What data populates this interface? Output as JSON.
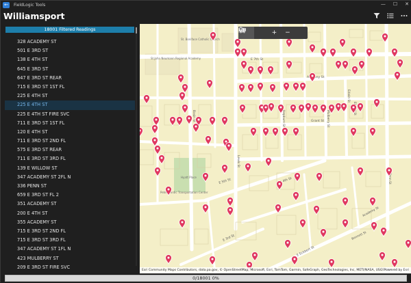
{
  "titlebar": {
    "back_glyph": "←",
    "app_title": "FieldLogic Tools",
    "minimize_glyph": "—",
    "maximize_glyph": "☐",
    "close_glyph": "✕"
  },
  "header": {
    "title": "Williamsport",
    "filter_icon": "filter-icon",
    "list_icon": "list-icon",
    "more_icon": "more-icon"
  },
  "sidebar": {
    "filter_label": "18001 Filtered Readings",
    "items": [
      "328 ACADEMY ST",
      "501 E 3RD ST",
      "138 E 4TH ST",
      "645 E 3RD ST",
      "647 E 3RD ST REAR",
      "715 E 3RD ST 1ST FL",
      "225 E 4TH ST",
      "225 E 4TH ST",
      "225 E 4TH ST FIRE SVC",
      "711 E 3RD ST 1ST FL",
      "120 E 4TH ST",
      "711 E 3RD ST 2ND FL",
      "575 E 3RD ST REAR",
      "711 E 3RD ST 3RD FL",
      "139 E WILLOW ST",
      "347 ACADEMY ST 2FL N",
      "336 PENN ST",
      "659 E 3RD ST FL 2",
      "351 ACADEMY ST",
      "200 E 4TH ST",
      "355 ACADEMY ST",
      "715 E 3RD ST 2ND FL",
      "715 E 3RD ST 3RD FL",
      "347 ACADEMY ST 1FL N",
      "423 MULBERRY ST",
      "209 E 3RD ST FIRE SVC"
    ],
    "selected_index": 7
  },
  "map": {
    "toolbar": {
      "vehicle_icon": "vehicle-icon",
      "layers_icon": "layers-icon",
      "zoom_in_label": "+",
      "zoom_out_label": "−",
      "locate_icon": "location-pin-icon",
      "screenshot_icon": "camera-icon"
    },
    "streets": {
      "e_7th": "E 7th St",
      "anthony": "Anthony St",
      "grant": "Grant St",
      "e_5th": "E 5th St",
      "e_4th": "E 4th St",
      "e_3rd": "E 3rd St",
      "basin": "Basin St",
      "lewis": "Lewis St",
      "hepburn": "Hepburn St",
      "mulberry": "Mulberry St",
      "penn": "Penn St",
      "edwin": "Edwin St",
      "eldred": "Eldred St",
      "academy": "Academy St",
      "bennett": "Bennett St",
      "e_eckbert": "E Eckbert St"
    },
    "pois": {
      "st_boniface": "St. Boniface Catholic Church",
      "st_john": "St John Neumann Regional Academy",
      "hyatt": "Hyatt Place",
      "peter": "Peter Herdic Transportation Center",
      "pin_color": "#e03860"
    },
    "attribution": "Esri Community Maps Contributors, data.pa.gov, © OpenStreetMap, Microsoft, Esri, TomTom, Garmin, SafeGraph, GeoTechnologies, Inc, METI/NASA, USGS, EPA, N...",
    "powered_by": "Powered by Esri"
  },
  "status": {
    "progress_text": "0/18001 0%",
    "progress_fraction": 0
  },
  "colors": {
    "accent": "#1d7eaa",
    "selected_text": "#76b6ea",
    "map_background": "#f4efc8",
    "pin": "#e03860"
  }
}
